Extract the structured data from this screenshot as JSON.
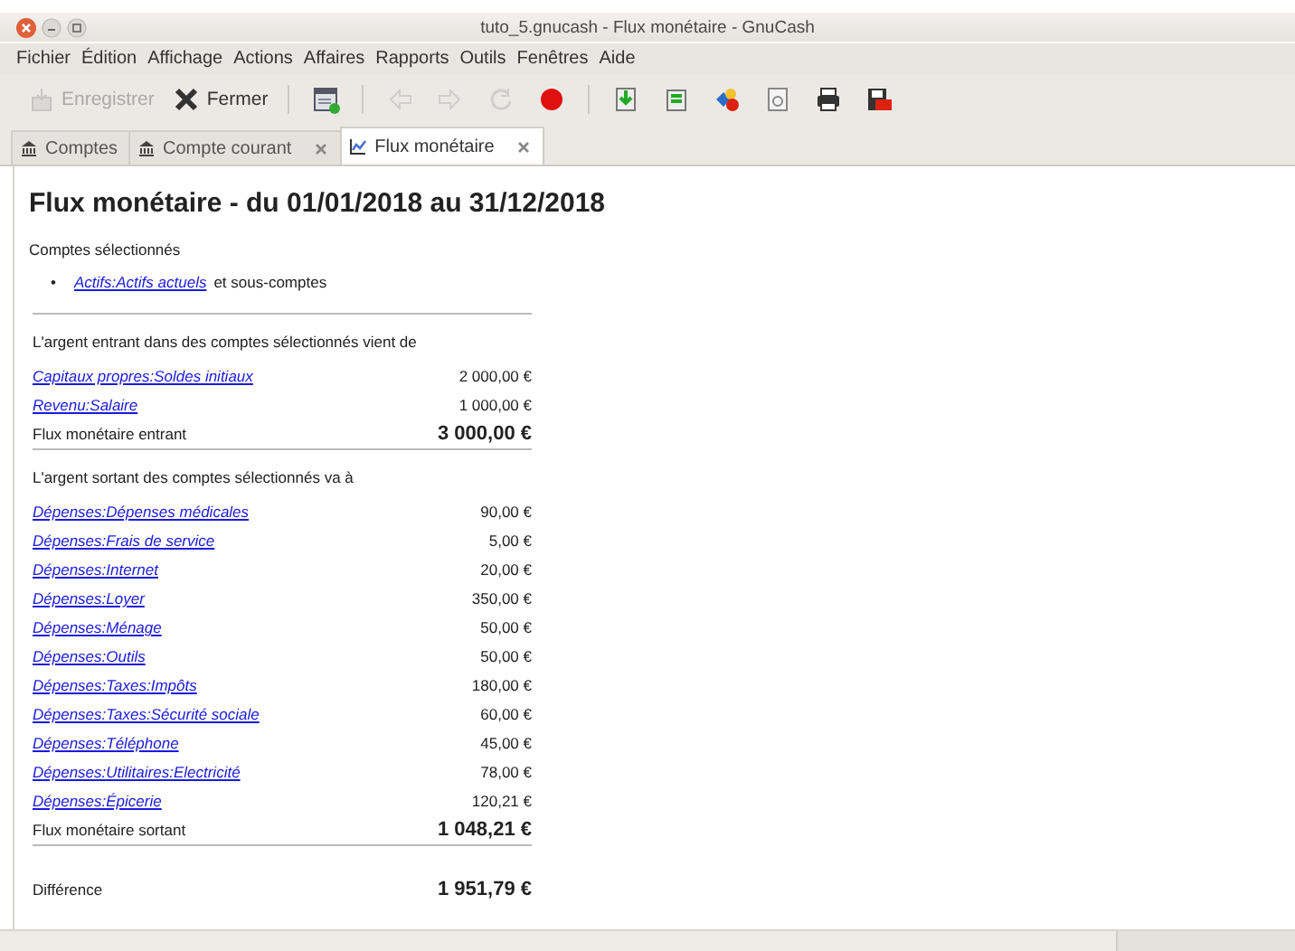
{
  "window": {
    "title": "tuto_5.gnucash - Flux monétaire - GnuCash"
  },
  "menu": [
    "Fichier",
    "Édition",
    "Affichage",
    "Actions",
    "Affaires",
    "Rapports",
    "Outils",
    "Fenêtres",
    "Aide"
  ],
  "toolbar": [
    {
      "kind": "labeled",
      "label": "Enregistrer",
      "disabled": true
    },
    {
      "kind": "labeled",
      "label": "Fermer",
      "disabled": false
    },
    {
      "kind": "separator"
    },
    {
      "kind": "icon",
      "disabled": false
    },
    {
      "kind": "separator"
    },
    {
      "kind": "icon",
      "disabled": true
    },
    {
      "kind": "icon",
      "disabled": true
    },
    {
      "kind": "icon",
      "disabled": true
    },
    {
      "kind": "icon",
      "disabled": false
    },
    {
      "kind": "separator"
    },
    {
      "kind": "icon",
      "disabled": false
    },
    {
      "kind": "icon",
      "disabled": false
    },
    {
      "kind": "icon",
      "disabled": false
    },
    {
      "kind": "icon",
      "disabled": false
    },
    {
      "kind": "icon",
      "disabled": false
    },
    {
      "kind": "icon",
      "disabled": false
    }
  ],
  "tabs": [
    {
      "label": "Comptes",
      "selected": false,
      "closable": false
    },
    {
      "label": "Compte courant",
      "selected": false,
      "closable": true
    },
    {
      "label": "Flux monétaire",
      "selected": true,
      "closable": true
    }
  ],
  "report": {
    "title": "Flux monétaire - du 01/01/2018 au 31/12/2018",
    "selected_heading": "Comptes sélectionnés",
    "selected_accounts": [
      {
        "marker": "•",
        "link": "Actifs:Actifs actuels",
        "suffix": "et sous-comptes"
      }
    ],
    "sections": [
      {
        "heading": "L'argent entrant dans des comptes sélectionnés vient de",
        "rows": [
          {
            "account": "Capitaux propres:Soldes initiaux",
            "amount": "2 000,00 €"
          },
          {
            "account": "Revenu:Salaire",
            "amount": "1 000,00 €"
          }
        ],
        "total_label": "Flux monétaire entrant",
        "total": "3 000,00 €"
      },
      {
        "heading": "L'argent sortant des comptes sélectionnés va à",
        "rows": [
          {
            "account": "Dépenses:Dépenses médicales",
            "amount": "90,00 €"
          },
          {
            "account": "Dépenses:Frais de service",
            "amount": "5,00 €"
          },
          {
            "account": "Dépenses:Internet",
            "amount": "20,00 €"
          },
          {
            "account": "Dépenses:Loyer",
            "amount": "350,00 €"
          },
          {
            "account": "Dépenses:Ménage",
            "amount": "50,00 €"
          },
          {
            "account": "Dépenses:Outils",
            "amount": "50,00 €"
          },
          {
            "account": "Dépenses:Taxes:Impôts",
            "amount": "180,00 €"
          },
          {
            "account": "Dépenses:Taxes:Sécurité sociale",
            "amount": "60,00 €"
          },
          {
            "account": "Dépenses:Téléphone",
            "amount": "45,00 €"
          },
          {
            "account": "Dépenses:Utilitaires:Electricité",
            "amount": "78,00 €"
          },
          {
            "account": "Dépenses:Épicerie",
            "amount": "120,21 €"
          }
        ],
        "total_label": "Flux monétaire sortant",
        "total": "1 048,21 €"
      }
    ],
    "difference": {
      "label": "Différence",
      "amount": "1 951,79 €"
    }
  }
}
